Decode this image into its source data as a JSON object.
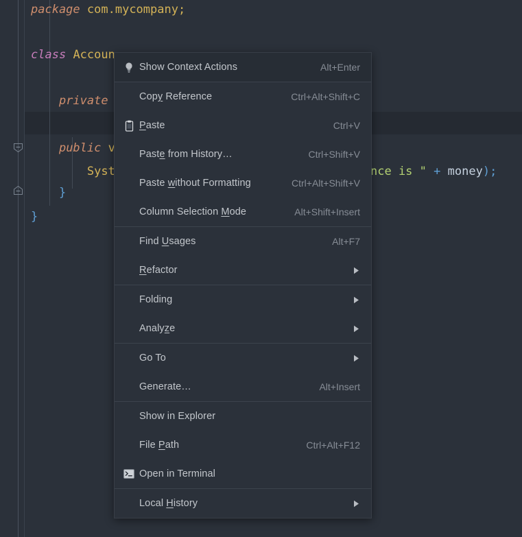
{
  "editor": {
    "background_color": "#2b313a",
    "current_line_color": "#252a32",
    "lines": [
      {
        "id": "line-package",
        "text": "package com.mycompany;"
      },
      {
        "id": "line-blank-1",
        "text": ""
      },
      {
        "id": "line-class",
        "text": "class Account {"
      },
      {
        "id": "line-blank-2",
        "text": ""
      },
      {
        "id": "line-private",
        "text": "    private"
      },
      {
        "id": "line-current",
        "text": ""
      },
      {
        "id": "line-public",
        "text": "    public v"
      },
      {
        "id": "line-sysout",
        "text": "        Syst                                nce is \" + money);"
      },
      {
        "id": "line-close-method",
        "text": "    }"
      },
      {
        "id": "line-close-class",
        "text": "}"
      }
    ],
    "tokens": {
      "package_keyword": "package",
      "package_name": "com.mycompany;",
      "class_keyword": "class",
      "class_name": "Accoun",
      "class_brace": "{",
      "private_keyword": "private",
      "public_keyword": "public",
      "public_tail": "v",
      "sysout_head": "Syst",
      "string_tail": "nce is \"",
      "plus_op": "+",
      "money_var": "money",
      "call_close": ");",
      "method_close_brace": "}",
      "class_close_brace": "}"
    }
  },
  "context_menu": {
    "groups": [
      {
        "id": "group-context-actions",
        "items": [
          {
            "id": "show-context-actions",
            "label": "Show Context Actions",
            "shortcut": "Alt+Enter",
            "icon": "lightbulb-icon",
            "submenu": false,
            "highlighted": true
          }
        ]
      },
      {
        "id": "group-clipboard",
        "items": [
          {
            "id": "copy-reference",
            "label": "Copy Reference",
            "label_pre": "Cop",
            "label_mnemonic": "y",
            "label_post": " Reference",
            "shortcut": "Ctrl+Alt+Shift+C",
            "icon": null,
            "submenu": false
          },
          {
            "id": "paste",
            "label": "Paste",
            "label_pre": "",
            "label_mnemonic": "P",
            "label_post": "aste",
            "shortcut": "Ctrl+V",
            "icon": "clipboard-icon",
            "submenu": false
          },
          {
            "id": "paste-from-history",
            "label": "Paste from History…",
            "label_pre": "Past",
            "label_mnemonic": "e",
            "label_post": " from History…",
            "shortcut": "Ctrl+Shift+V",
            "icon": null,
            "submenu": false
          },
          {
            "id": "paste-without-formatting",
            "label": "Paste without Formatting",
            "label_pre": "Paste ",
            "label_mnemonic": "w",
            "label_post": "ithout Formatting",
            "shortcut": "Ctrl+Alt+Shift+V",
            "icon": null,
            "submenu": false
          },
          {
            "id": "column-selection-mode",
            "label": "Column Selection Mode",
            "label_pre": "Column Selection ",
            "label_mnemonic": "M",
            "label_post": "ode",
            "shortcut": "Alt+Shift+Insert",
            "icon": null,
            "submenu": false
          }
        ]
      },
      {
        "id": "group-find-refactor",
        "items": [
          {
            "id": "find-usages",
            "label": "Find Usages",
            "label_pre": "Find ",
            "label_mnemonic": "U",
            "label_post": "sages",
            "shortcut": "Alt+F7",
            "icon": null,
            "submenu": false
          },
          {
            "id": "refactor",
            "label": "Refactor",
            "label_pre": "",
            "label_mnemonic": "R",
            "label_post": "efactor",
            "shortcut": "",
            "icon": null,
            "submenu": true
          }
        ]
      },
      {
        "id": "group-folding-analyze",
        "items": [
          {
            "id": "folding",
            "label": "Folding",
            "label_pre": "Folding",
            "label_mnemonic": "",
            "label_post": "",
            "shortcut": "",
            "icon": null,
            "submenu": true
          },
          {
            "id": "analyze",
            "label": "Analyze",
            "label_pre": "Analy",
            "label_mnemonic": "z",
            "label_post": "e",
            "shortcut": "",
            "icon": null,
            "submenu": true
          }
        ]
      },
      {
        "id": "group-goto-generate",
        "items": [
          {
            "id": "go-to",
            "label": "Go To",
            "label_pre": "Go To",
            "label_mnemonic": "",
            "label_post": "",
            "shortcut": "",
            "icon": null,
            "submenu": true
          },
          {
            "id": "generate",
            "label": "Generate…",
            "label_pre": "Generate…",
            "label_mnemonic": "",
            "label_post": "",
            "shortcut": "Alt+Insert",
            "icon": null,
            "submenu": false
          }
        ]
      },
      {
        "id": "group-file",
        "items": [
          {
            "id": "show-in-explorer",
            "label": "Show in Explorer",
            "label_pre": "Show in Explorer",
            "label_mnemonic": "",
            "label_post": "",
            "shortcut": "",
            "icon": null,
            "submenu": false
          },
          {
            "id": "file-path",
            "label": "File Path",
            "label_pre": "File ",
            "label_mnemonic": "P",
            "label_post": "ath",
            "shortcut": "Ctrl+Alt+F12",
            "icon": null,
            "submenu": false
          },
          {
            "id": "open-in-terminal",
            "label": "Open in Terminal",
            "label_pre": "Open in Terminal",
            "label_mnemonic": "",
            "label_post": "",
            "shortcut": "",
            "icon": "terminal-icon",
            "submenu": false
          }
        ]
      },
      {
        "id": "group-local-history",
        "items": [
          {
            "id": "local-history",
            "label": "Local History",
            "label_pre": "Local ",
            "label_mnemonic": "H",
            "label_post": "istory",
            "shortcut": "",
            "icon": null,
            "submenu": true
          }
        ]
      }
    ]
  }
}
